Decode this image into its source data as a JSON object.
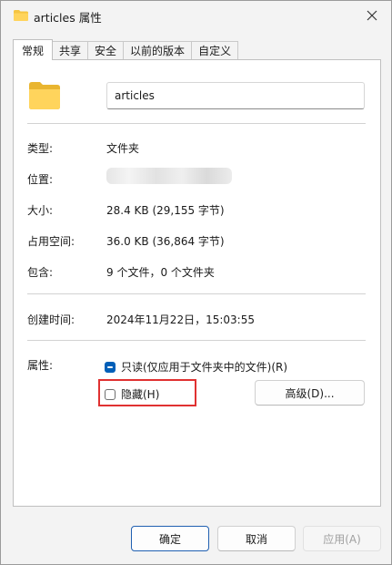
{
  "window": {
    "title": "articles 属性"
  },
  "tabs": [
    {
      "label": "常规",
      "active": true
    },
    {
      "label": "共享",
      "active": false
    },
    {
      "label": "安全",
      "active": false
    },
    {
      "label": "以前的版本",
      "active": false
    },
    {
      "label": "自定义",
      "active": false
    }
  ],
  "general": {
    "folder_name": "articles",
    "type_label": "类型:",
    "type_value": "文件夹",
    "location_label": "位置:",
    "size_label": "大小:",
    "size_value": "28.4 KB (29,155 字节)",
    "disk_size_label": "占用空间:",
    "disk_size_value": "36.0 KB (36,864 字节)",
    "contains_label": "包含:",
    "contains_value": "9 个文件，0 个文件夹",
    "created_label": "创建时间:",
    "created_value": "2024年11月22日，15:03:55",
    "attributes_label": "属性:",
    "readonly_label": "只读(仅应用于文件夹中的文件)(R)",
    "hidden_label": "隐藏(H)",
    "advanced_label": "高级(D)..."
  },
  "footer": {
    "ok_label": "确定",
    "cancel_label": "取消",
    "apply_label": "应用(A)"
  },
  "colors": {
    "accent": "#005fb8",
    "highlight": "#e03131",
    "folder": "#f5c542"
  },
  "icons": {
    "title": "folder-icon",
    "close": "close-icon",
    "folder": "folder-icon"
  }
}
